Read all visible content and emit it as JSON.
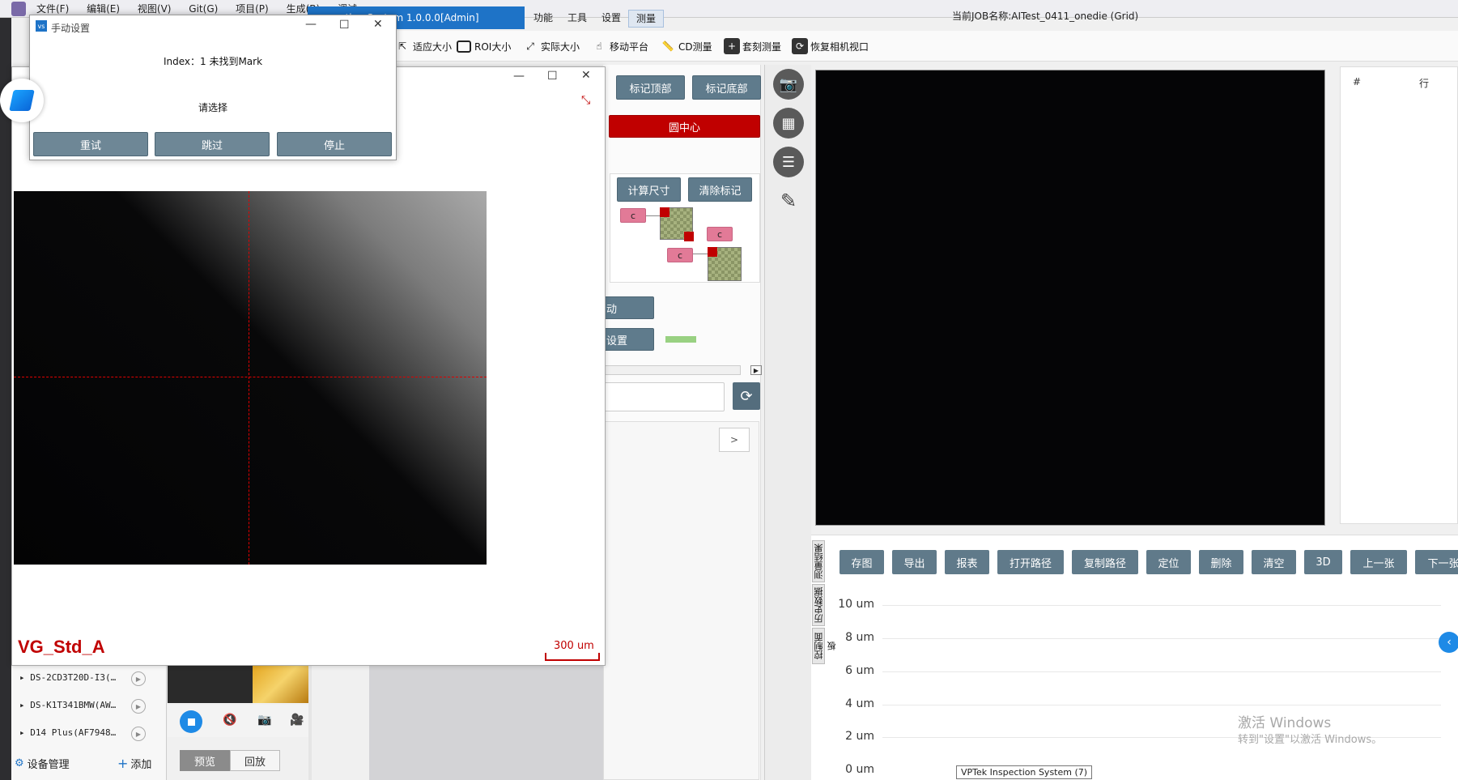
{
  "menubar": {
    "items": [
      "文件(F)",
      "编辑(E)",
      "视图(V)",
      "Git(G)",
      "项目(P)",
      "生成(B)",
      "调试"
    ],
    "app_title": "ction System 1.0.0.0[Admin]",
    "app_menus": [
      "功能",
      "工具",
      "设置",
      "测量"
    ],
    "job_label": "当前JOB名称:",
    "job_name": "AITest_0411_onedie (Grid)"
  },
  "toolbar": {
    "fit": "适应大小",
    "roi": "ROI大小",
    "actual": "实际大小",
    "move": "移动平台",
    "cd": "CD测量",
    "overlay": "套刻测量",
    "restore": "恢复相机视口"
  },
  "dialog": {
    "title": "手动设置",
    "message": "Index：1 未找到Mark",
    "prompt": "请选择",
    "retry": "重试",
    "skip": "跳过",
    "stop": "停止"
  },
  "image_window": {
    "label": "VG_Std_A",
    "scale": "300 um"
  },
  "measure_panel": {
    "mark_top": "标记顶部",
    "mark_bottom": "标记底部",
    "circle_center": "圆中心",
    "calc_size": "计算尺寸",
    "clear_marks": "清除标记",
    "chip_label": "c",
    "auto_btn": "动",
    "settings_btn": "设置",
    "nav_next": ">"
  },
  "table": {
    "col_hash": "#",
    "col_row": "行"
  },
  "results": {
    "buttons": [
      "存图",
      "导出",
      "报表",
      "打开路径",
      "复制路径",
      "定位",
      "删除",
      "清空",
      "3D",
      "上一张",
      "下一张"
    ],
    "tabs": [
      "测量结果",
      "历史数据",
      "控制面板"
    ]
  },
  "chart_data": {
    "type": "line",
    "y_ticks": [
      "10 um",
      "8 um",
      "6 um",
      "4 um",
      "2 um",
      "0 um"
    ],
    "ylim": [
      0,
      10
    ],
    "series": []
  },
  "devices": {
    "items": [
      "DS-2CD3T20D-I3(…",
      "DS-K1T341BMW(AW…",
      "D14 Plus(AF7948…"
    ],
    "manage": "设备管理",
    "add": "添加",
    "preview": "预览",
    "playback": "回放"
  },
  "taskbar_tooltip": "VPTek Inspection System (7)",
  "watermark": {
    "line1": "激活 Windows",
    "line2": "转到\"设置\"以激活 Windows。"
  }
}
